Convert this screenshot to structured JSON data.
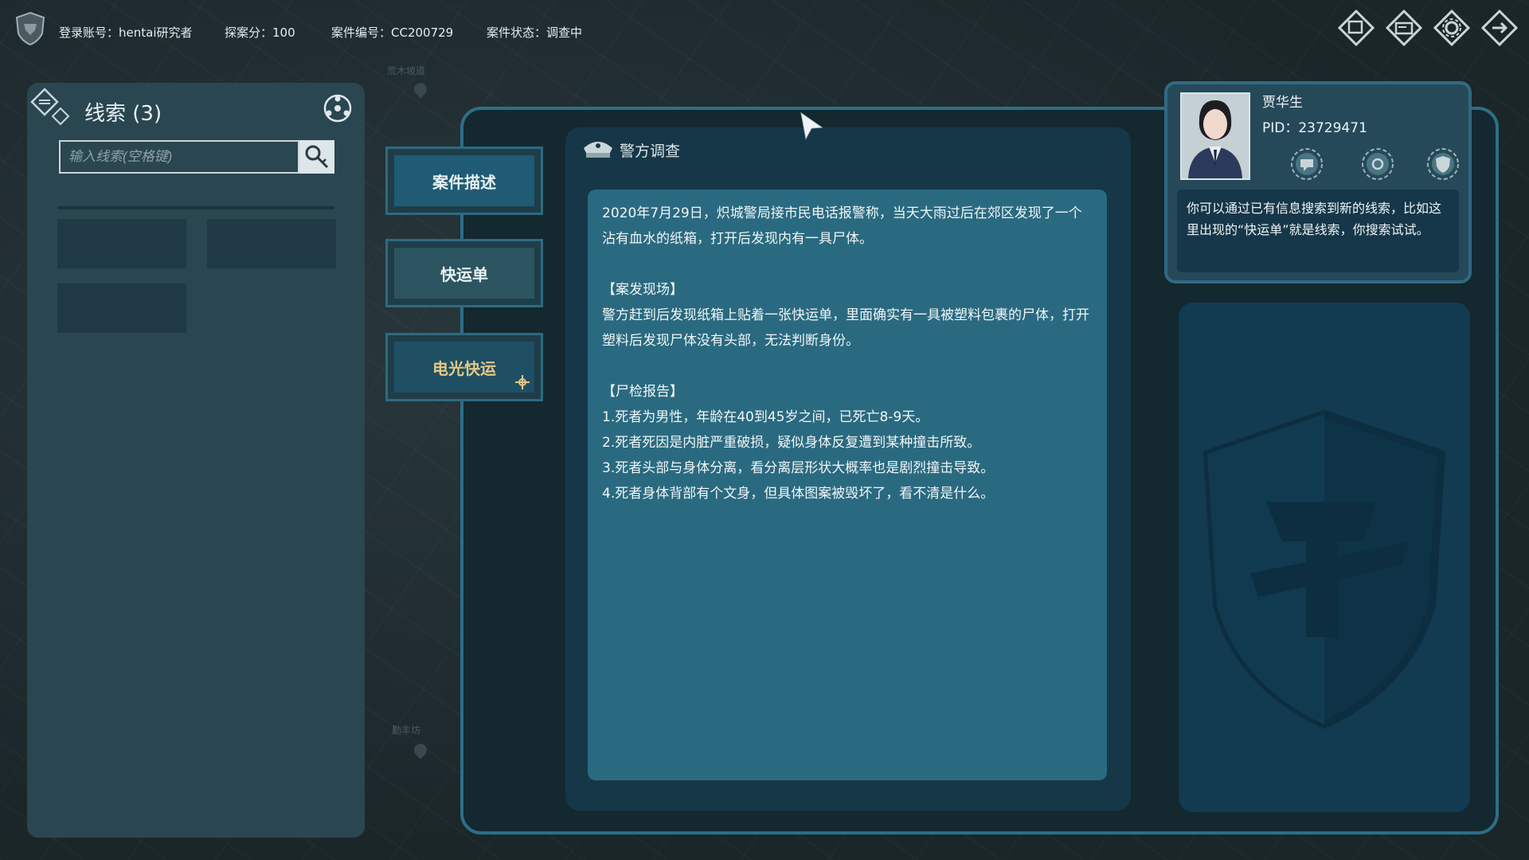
{
  "topbar": {
    "account_label": "登录账号：hentai研究者",
    "score_label": "探案分：100",
    "case_id_label": "案件编号：CC200729",
    "case_status_label": "案件状态：调查中"
  },
  "map_labels": [
    "荒木坡道",
    "勤丰坊"
  ],
  "clues": {
    "title": "线索 (3)",
    "search_placeholder": "输入线索(空格键)"
  },
  "tabs": [
    {
      "label": "案件描述"
    },
    {
      "label": "快运单"
    },
    {
      "label": "电光快运"
    }
  ],
  "document": {
    "title": "警方调查",
    "intro": "2020年7月29日，炽城警局接市民电话报警称，当天大雨过后在郊区发现了一个沾有血水的纸箱，打开后发现内有一具尸体。",
    "scene_heading": "【案发现场】",
    "scene_text": "警方赶到后发现纸箱上贴着一张快运单，里面确实有一具被塑料包裹的尸体，打开塑料后发现尸体没有头部，无法判断身份。",
    "autopsy_heading": "【尸检报告】",
    "autopsy_items": [
      "1.死者为男性，年龄在40到45岁之间，已死亡8-9天。",
      "2.死者死因是内脏严重破损，疑似身体反复遭到某种撞击所致。",
      "3.死者头部与身体分离，看分离层形状大概率也是剧烈撞击导致。",
      "4.死者身体背部有个文身，但具体图案被毁坏了，看不清是什么。"
    ]
  },
  "character": {
    "name": "贾华生",
    "pid": "PID：23729471",
    "message": "你可以通过已有信息搜索到新的线索，比如这里出现的“快运单”就是线索，你搜索试试。"
  },
  "colors": {
    "accent": "#2d6e88",
    "doc_body": "#2a6a80",
    "panel": "#2a4650",
    "gold_text": "#e2c888"
  }
}
